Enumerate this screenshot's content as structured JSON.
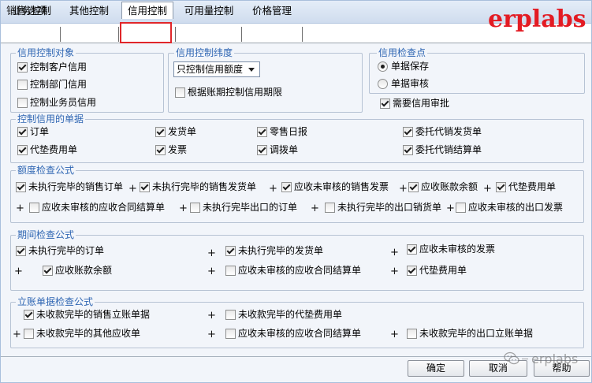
{
  "window": {
    "title": "销售选项"
  },
  "watermark": {
    "brand": "erplabs",
    "bottom_brand": "erplabs"
  },
  "tabs": [
    {
      "label": "业务控制",
      "selected": false
    },
    {
      "label": "其他控制",
      "selected": false
    },
    {
      "label": "信用控制",
      "selected": true
    },
    {
      "label": "可用量控制",
      "selected": false
    },
    {
      "label": "价格管理",
      "selected": false
    }
  ],
  "formula_operator": "+",
  "credit_object": {
    "legend": "信用控制对象",
    "items": [
      {
        "label": "控制客户信用",
        "checked": true
      },
      {
        "label": "控制部门信用",
        "checked": false
      },
      {
        "label": "控制业务员信用",
        "checked": false
      }
    ]
  },
  "credit_dimension": {
    "legend": "信用控制纬度",
    "select_value": "只控制信用额度",
    "items": [
      {
        "label": "根据账期控制信用期限",
        "checked": false
      }
    ]
  },
  "check_point": {
    "legend": "信用检查点",
    "options": [
      {
        "label": "单据保存",
        "selected": true
      },
      {
        "label": "单据审核",
        "selected": false
      }
    ],
    "approval": {
      "label": "需要信用审批",
      "checked": true
    }
  },
  "controlled_docs": {
    "legend": "控制信用的单据",
    "items": [
      {
        "label": "订单",
        "checked": true
      },
      {
        "label": "发货单",
        "checked": true
      },
      {
        "label": "零售日报",
        "checked": true
      },
      {
        "label": "委托代销发货单",
        "checked": true
      },
      {
        "label": "代垫费用单",
        "checked": true
      },
      {
        "label": "发票",
        "checked": true
      },
      {
        "label": "调拨单",
        "checked": true
      },
      {
        "label": "委托代销结算单",
        "checked": true
      }
    ]
  },
  "limit_formula": {
    "legend": "额度检查公式",
    "items": [
      {
        "label": "未执行完毕的销售订单",
        "checked": true
      },
      {
        "label": "未执行完毕的销售发货单",
        "checked": true
      },
      {
        "label": "应收未审核的销售发票",
        "checked": true
      },
      {
        "label": "应收账款余额",
        "checked": true
      },
      {
        "label": "代垫费用单",
        "checked": true
      },
      {
        "label": "应收未审核的应收合同结算单",
        "checked": false
      },
      {
        "label": "未执行完毕出口的订单",
        "checked": false
      },
      {
        "label": "未执行完毕的出口销货单",
        "checked": false
      },
      {
        "label": "应收未审核的出口发票",
        "checked": false
      }
    ]
  },
  "period_formula": {
    "legend": "期间检查公式",
    "items": [
      {
        "label": "未执行完毕的订单",
        "checked": true
      },
      {
        "label": "未执行完毕的发货单",
        "checked": true
      },
      {
        "label": "应收未审核的发票",
        "checked": true
      },
      {
        "label": "应收账款余额",
        "checked": true
      },
      {
        "label": "应收未审核的应收合同结算单",
        "checked": false
      },
      {
        "label": "代垫费用单",
        "checked": true
      }
    ]
  },
  "ledger_formula": {
    "legend": "立账单据检查公式",
    "items": [
      {
        "label": "未收款完毕的销售立账单据",
        "checked": true
      },
      {
        "label": "未收款完毕的代垫费用单",
        "checked": false
      },
      {
        "label": "未收款完毕的其他应收单",
        "checked": false
      },
      {
        "label": "应收未审核的应收合同结算单",
        "checked": false
      },
      {
        "label": "未收款完毕的出口立账单据",
        "checked": false
      }
    ]
  },
  "buttons": {
    "ok": "确定",
    "cancel": "取消",
    "help": "帮助"
  },
  "colors": {
    "brand_red": "#e31b23",
    "legend_blue": "#2f66b3",
    "highlight_red": "#e0262a"
  }
}
